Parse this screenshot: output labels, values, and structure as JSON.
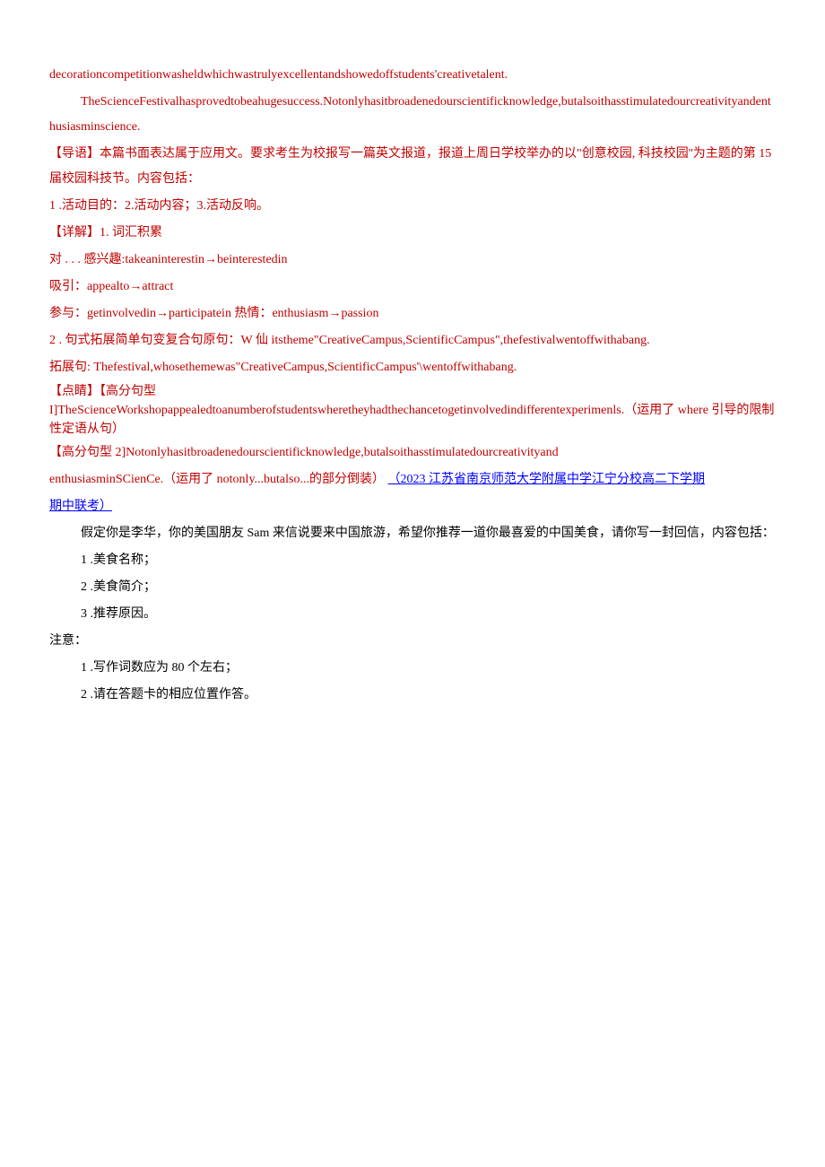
{
  "p1": "decorationcompetitionwasheldwhichwastrulyexcellentandshowedoffstudents'creativetalent.",
  "p2": "TheScienceFestivalhasprovedtobeahugesuccess.Notonlyhasitbroadenedourscientificknowledge,butalsoithasstimulatedourcreativityandenthusiasminscience.",
  "p3": "【导语】本篇书面表达属于应用文。要求考生为校报写一篇英文报道，报道上周日学校举办的以\"创意校园, 科技校园''为主题的第 15 届校园科技节。内容包括：",
  "p4": "1 .活动目的：2.活动内容；3.活动反响。",
  "p5": "【详解】1. 词汇积累",
  "p6": "对 . . . 感兴趣:takeaninterestin→beinterestedin",
  "p7": "吸引：appealto→attract",
  "p8": "参与：getinvolvedin→participatein 热情：enthusiasm→passion",
  "p9": "2 . 句式拓展简单句变复合句原句：W 仙 itstheme\"CreativeCampus,ScientificCampus\",thefestivalwentoffwithabang.",
  "p10": "拓展句: Thefestival,whosethemewas\"CreativeCampus,ScientificCampus'\\wentoffwithabang.",
  "p11a": "【点睛】【高分句型",
  "p11b": "I]TheScienceWorkshopappealedtoanumberofstudentswheretheyhadthechancetogetinvolvedindifferentexperimenls.（运用了 where 引导的限制性定语从句）",
  "p12": "【高分句型 2]Notonlyhasitbroadenedourscientificknowledge,butalsoithasstimulatedourcreativityand",
  "p13a": "enthusiasminSCienCe.（运用了 notonly...butalso...的部分倒装）",
  "p13b": "（2023 江苏省南京师范大学附属中学江宁分校高二下学期",
  "p14": "期中联考）",
  "p15": "假定你是李华，你的美国朋友 Sam 来信说要来中国旅游，希望你推荐一道你最喜爱的中国美食，请你写一封回信，内容包括：",
  "p16": "1 .美食名称；",
  "p17": "2 .美食简介；",
  "p18": "3 .推荐原因。",
  "p19": "注意：",
  "p20": "1 .写作词数应为 80 个左右；",
  "p21": "2 .请在答题卡的相应位置作答。"
}
